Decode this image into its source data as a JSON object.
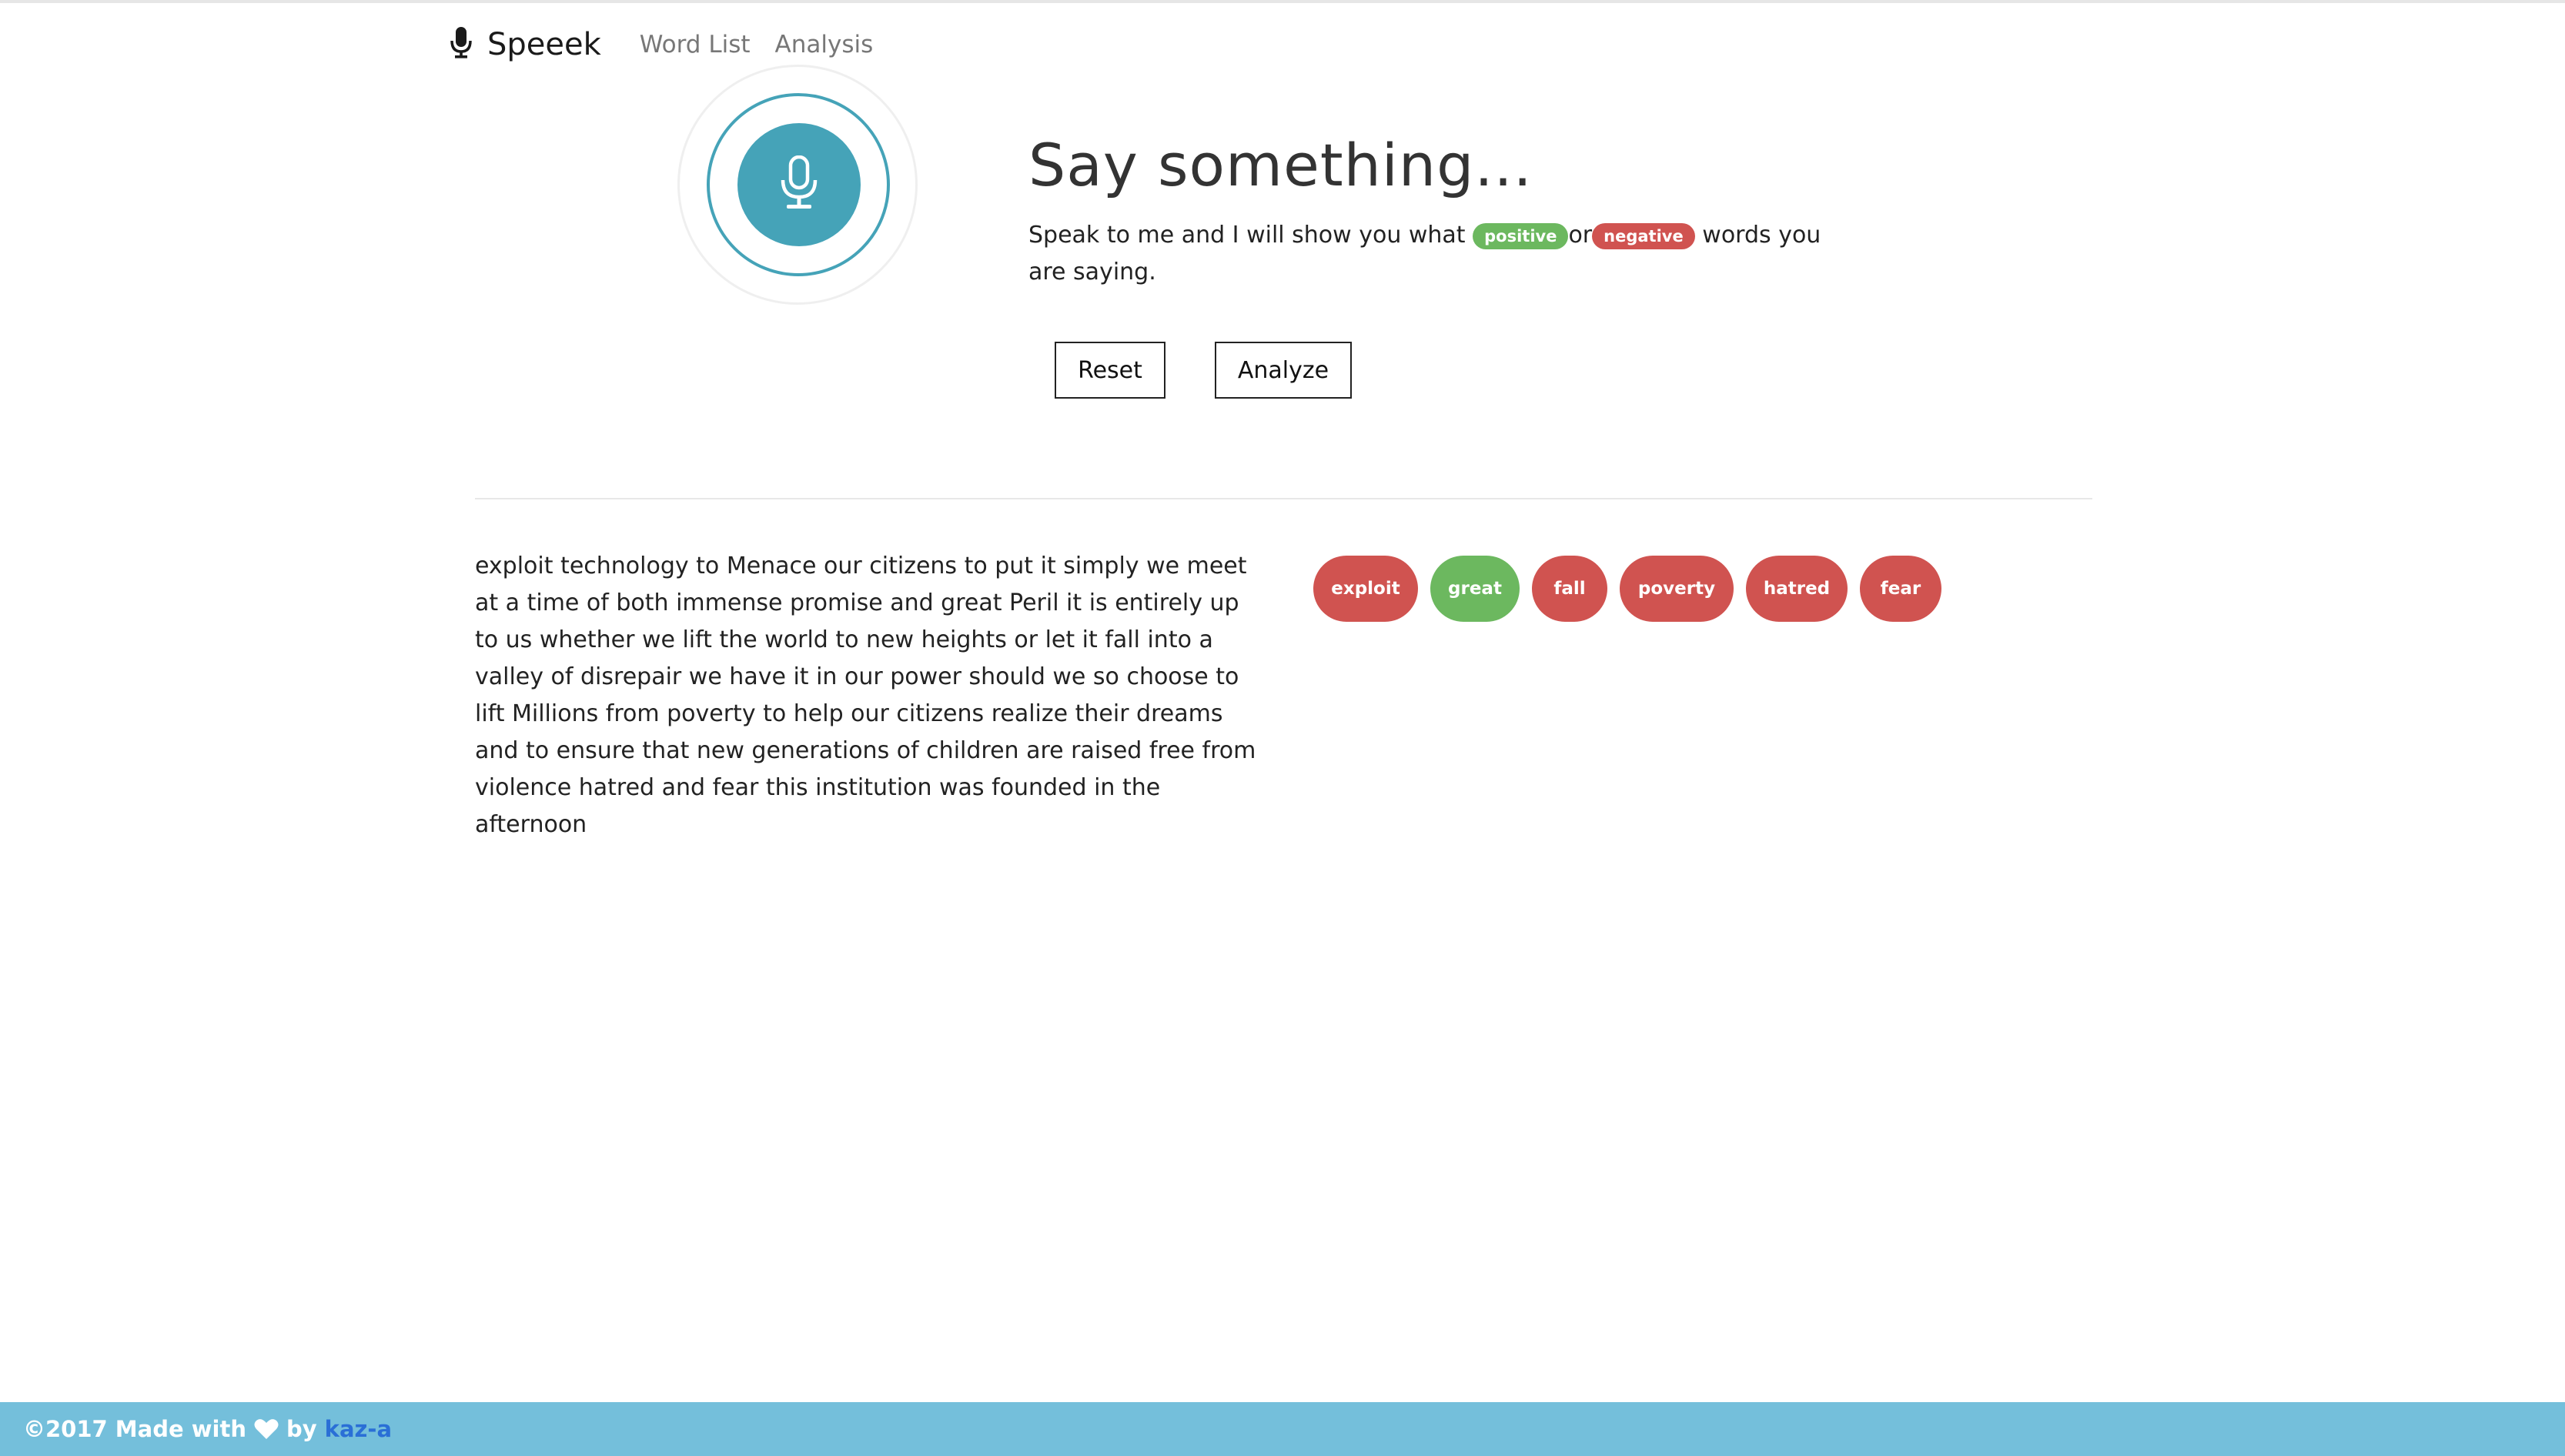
{
  "brand": {
    "label": "Speeek",
    "icon": "microphone-icon"
  },
  "nav": {
    "items": [
      {
        "label": "Word List"
      },
      {
        "label": "Analysis"
      }
    ]
  },
  "mic": {
    "icon": "microphone-icon",
    "color": "#45a3b8"
  },
  "heading": "Say something...",
  "subtext": {
    "before": "Speak to me and I will show you what",
    "positive": "positive",
    "or": "or",
    "negative": "negative",
    "after": "words you are saying."
  },
  "buttons": {
    "reset": "Reset",
    "analyze": "Analyze"
  },
  "transcript": "exploit technology to Menace our citizens to put it simply we meet at a time of both immense promise and great Peril it is entirely up to us whether we lift the world to new heights or let it fall into a valley of disrepair we have it in our power should we so choose to lift Millions from poverty to help our citizens realize their dreams and to ensure that new generations of children are raised free from violence hatred and fear this institution was founded in the afternoon",
  "words": [
    {
      "label": "exploit",
      "sentiment": "negative"
    },
    {
      "label": "great",
      "sentiment": "positive"
    },
    {
      "label": "fall",
      "sentiment": "negative"
    },
    {
      "label": "poverty",
      "sentiment": "negative"
    },
    {
      "label": "hatred",
      "sentiment": "negative"
    },
    {
      "label": "fear",
      "sentiment": "negative"
    }
  ],
  "footer": {
    "copyright": "©2017 Made with",
    "heart_icon": "heart-icon",
    "by": "by",
    "author": "kaz-a"
  },
  "colors": {
    "positive": "#6cb85f",
    "negative": "#d05350",
    "accent": "#45a3b8",
    "footer": "#74bfdb"
  }
}
